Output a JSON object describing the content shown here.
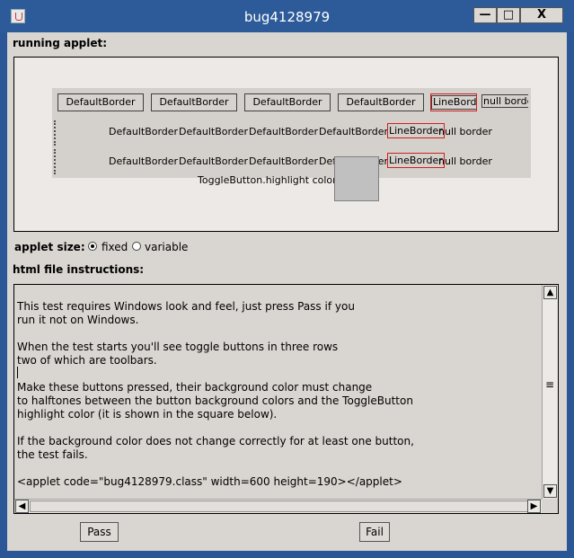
{
  "window": {
    "title": "bug4128979",
    "minimize": "—",
    "maximize": "□",
    "close": "X"
  },
  "labels": {
    "running_applet": "running applet:",
    "applet_size": "applet size:",
    "fixed": "fixed",
    "variable": "variable",
    "html_instructions": "html file instructions:"
  },
  "toolbar1": [
    "DefaultBorder",
    "DefaultBorder",
    "DefaultBorder",
    "DefaultBorder",
    "LineBorder",
    "null border"
  ],
  "toolbar2": [
    "DefaultBorder",
    "DefaultBorder",
    "DefaultBorder",
    "DefaultBorder",
    "LineBorder",
    "null border"
  ],
  "toolbar3": [
    "DefaultBorder",
    "DefaultBorder",
    "DefaultBorder",
    "DefaultBorder",
    "LineBorder",
    "null border"
  ],
  "highlight_label": "ToggleButton.highlight color:",
  "highlight_color": "#c0c0c0",
  "instructions": [
    "This test requires Windows look and feel, just press Pass if you",
    "run it not on Windows.",
    "When the test starts you'll see toggle buttons in three rows",
    "two of which are toolbars.",
    "Make these buttons pressed, their background color must change",
    "to halftones between the button background colors and the ToggleButton",
    "highlight color (it is shown in the square below).",
    "If the background color does not change correctly for at least one button,",
    "the test fails.",
    "<applet code=\"bug4128979.class\" width=600 height=190></applet>"
  ],
  "buttons": {
    "pass": "Pass",
    "fail": "Fail"
  }
}
